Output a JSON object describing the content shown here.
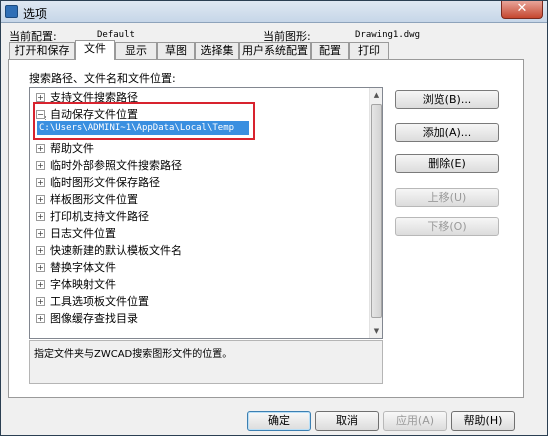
{
  "window": {
    "title": "选项",
    "close_label": "✕"
  },
  "header": {
    "current_config_label": "当前配置:",
    "current_config_value": "Default",
    "current_drawing_label": "当前图形:",
    "current_drawing_value": "Drawing1.dwg"
  },
  "tabs": [
    {
      "label": "打开和保存"
    },
    {
      "label": "文件"
    },
    {
      "label": "显示"
    },
    {
      "label": "草图"
    },
    {
      "label": "选择集"
    },
    {
      "label": "用户系统配置"
    },
    {
      "label": "配置"
    },
    {
      "label": "打印"
    }
  ],
  "panel": {
    "label": "搜索路径、文件名和文件位置:"
  },
  "tree": {
    "items": [
      {
        "label": "支持文件搜索路径",
        "expander": "+"
      },
      {
        "label": "自动保存文件位置",
        "expander": "−"
      },
      {
        "label": "帮助文件",
        "expander": "+"
      },
      {
        "label": "临时外部参照文件搜索路径",
        "expander": "+"
      },
      {
        "label": "临时图形文件保存路径",
        "expander": "+"
      },
      {
        "label": "样板图形文件位置",
        "expander": "+"
      },
      {
        "label": "打印机支持文件路径",
        "expander": "+"
      },
      {
        "label": "日志文件位置",
        "expander": "+"
      },
      {
        "label": "快速新建的默认模板文件名",
        "expander": "+"
      },
      {
        "label": "替换字体文件",
        "expander": "+"
      },
      {
        "label": "字体映射文件",
        "expander": "+"
      },
      {
        "label": "工具选项板文件位置",
        "expander": "+"
      },
      {
        "label": "图像缓存查找目录",
        "expander": "+"
      }
    ],
    "selected_child": "C:\\Users\\ADMINI~1\\AppData\\Local\\Temp"
  },
  "side_buttons": {
    "browse": "浏览(B)...",
    "add": "添加(A)...",
    "delete": "删除(E)",
    "move_up": "上移(U)",
    "move_down": "下移(O)"
  },
  "description": "指定文件夹与ZWCAD搜索图形文件的位置。",
  "footer": {
    "ok": "确定",
    "cancel": "取消",
    "apply": "应用(A)",
    "help": "帮助(H)"
  }
}
